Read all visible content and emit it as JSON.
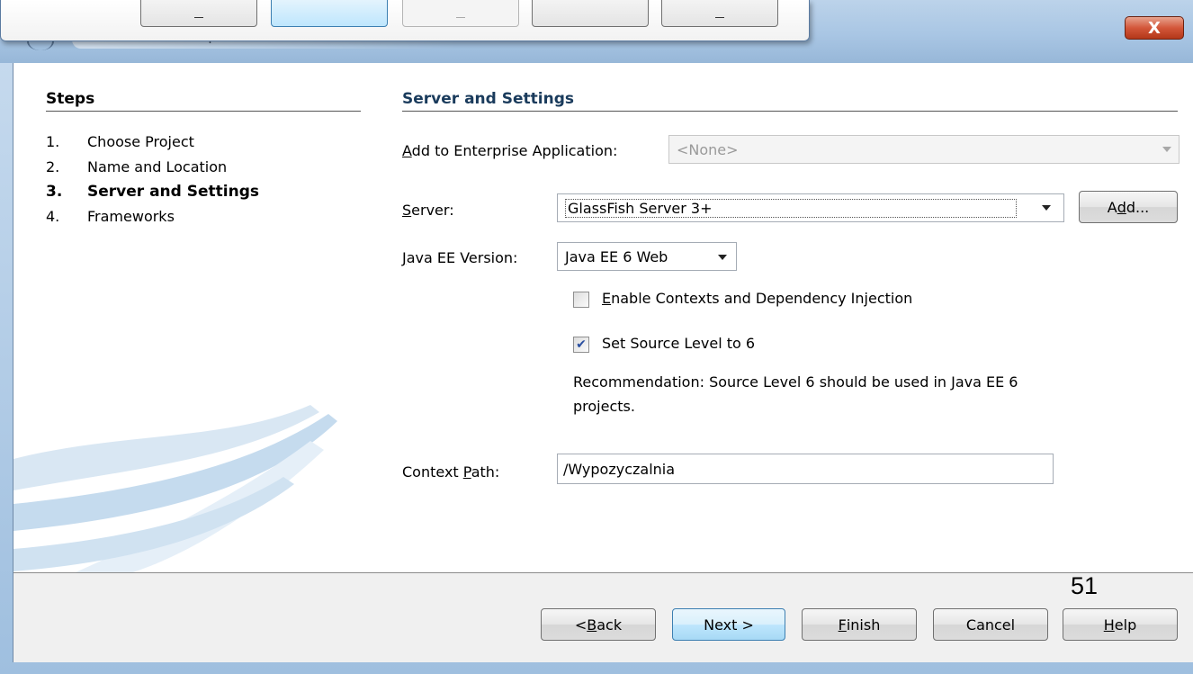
{
  "dialog": {
    "close_label": "X",
    "title_fragment": "' ·"
  },
  "steps": {
    "title": "Steps",
    "items": [
      {
        "num": "1.",
        "label": "Choose Project"
      },
      {
        "num": "2.",
        "label": "Name and Location"
      },
      {
        "num": "3.",
        "label": "Server and Settings"
      },
      {
        "num": "4.",
        "label": "Frameworks"
      }
    ]
  },
  "section": {
    "title": "Server and Settings"
  },
  "form": {
    "enterprise_label_prefix": "A",
    "enterprise_label_rest": "dd to Enterprise Application:",
    "enterprise_value": "<None>",
    "server_label_prefix": "S",
    "server_label_rest": "erver:",
    "server_value": "GlassFish Server 3+",
    "add_button_prefix": "A",
    "add_button_mn": "d",
    "add_button_rest": "d...",
    "javaee_label_prefix": "J",
    "javaee_label_rest": "ava EE Version:",
    "javaee_value": "Java EE 6 Web",
    "cdi_label_prefix": "E",
    "cdi_label_rest": "nable Contexts and Dependency Injection",
    "cdi_checked": false,
    "source_level_label": "Set Source Level to 6",
    "source_level_checked": true,
    "source_level_check_glyph": "✔",
    "recommendation_line1": "Recommendation: Source Level 6 should be used in Java EE 6",
    "recommendation_line2": "projects.",
    "context_label_prefix": "Context ",
    "context_label_mn": "P",
    "context_label_rest": "ath:",
    "context_value": "/Wypozyczalnia"
  },
  "buttons": {
    "back_prefix": "< ",
    "back_mn": "B",
    "back_rest": "ack",
    "next": "Next >",
    "finish_mn": "F",
    "finish_rest": "inish",
    "cancel": "Cancel",
    "help_mn": "H",
    "help_rest": "elp"
  },
  "page_number": "51",
  "colors": {
    "accent_default_button": "#3c7fb1",
    "section_title": "#1a3b5c",
    "close_button": "#d3573a"
  }
}
